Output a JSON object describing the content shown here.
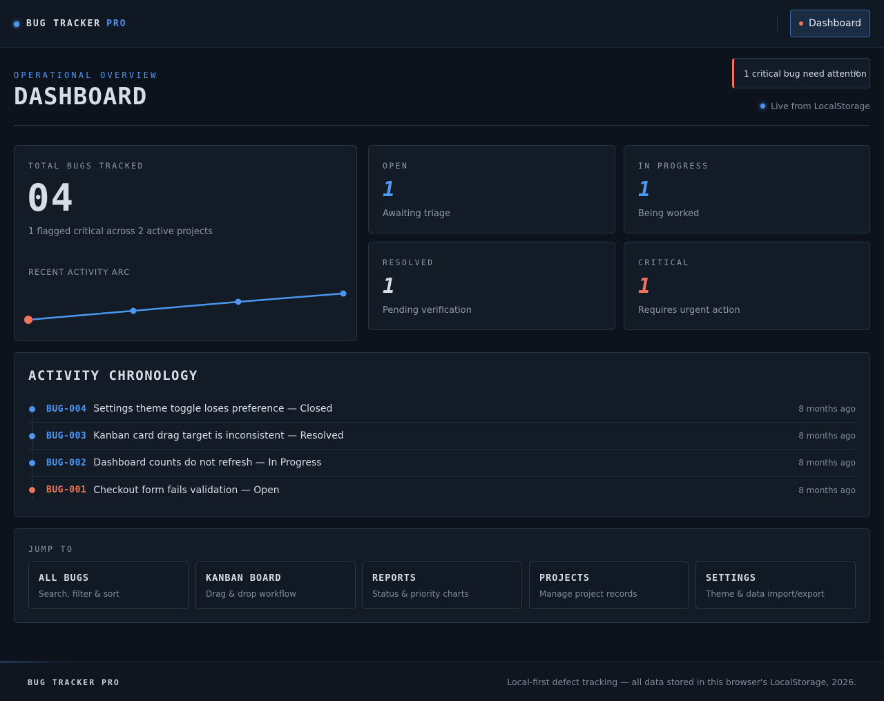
{
  "app": {
    "brand": "BUG TRACKER",
    "brand_suffix": "PRO"
  },
  "nav": {
    "active_label": "Dashboard"
  },
  "header": {
    "eyebrow": "OPERATIONAL OVERVIEW",
    "title": "DASHBOARD"
  },
  "alert": {
    "text": "1 critical bug need attention",
    "close": "×"
  },
  "live": {
    "text": "Live from LocalStorage"
  },
  "total": {
    "label": "TOTAL BUGS TRACKED",
    "value": "04",
    "subtitle": "1 flagged critical across 2 active projects",
    "arc_label": "RECENT ACTIVITY ARC"
  },
  "stats": {
    "open": {
      "label": "OPEN",
      "value": "1",
      "sub": "Awaiting triage",
      "color": "#4d97f0"
    },
    "in_progress": {
      "label": "IN PROGRESS",
      "value": "1",
      "sub": "Being worked",
      "color": "#4d97f0"
    },
    "resolved": {
      "label": "RESOLVED",
      "value": "1",
      "sub": "Pending verification",
      "color": "#d6dde6"
    },
    "critical": {
      "label": "CRITICAL",
      "value": "1",
      "sub": "Requires urgent action",
      "color": "#f0745a"
    }
  },
  "activity": {
    "title": "ACTIVITY CHRONOLOGY",
    "items": [
      {
        "id": "BUG-004",
        "text": "Settings theme toggle loses preference — Closed",
        "time": "8 months ago",
        "color": "#4d97f0"
      },
      {
        "id": "BUG-003",
        "text": "Kanban card drag target is inconsistent — Resolved",
        "time": "8 months ago",
        "color": "#4d97f0"
      },
      {
        "id": "BUG-002",
        "text": "Dashboard counts do not refresh — In Progress",
        "time": "8 months ago",
        "color": "#4d97f0"
      },
      {
        "id": "BUG-001",
        "text": "Checkout form fails validation — Open",
        "time": "8 months ago",
        "color": "#f0745a"
      }
    ]
  },
  "jump": {
    "label": "JUMP TO",
    "tiles": [
      {
        "title": "ALL BUGS",
        "sub": "Search, filter & sort"
      },
      {
        "title": "KANBAN BOARD",
        "sub": "Drag & drop workflow"
      },
      {
        "title": "REPORTS",
        "sub": "Status & priority charts"
      },
      {
        "title": "PROJECTS",
        "sub": "Manage project records"
      },
      {
        "title": "SETTINGS",
        "sub": "Theme & data import/export"
      }
    ]
  },
  "footer": {
    "brand": "BUG TRACKER PRO",
    "note": "Local-first defect tracking — all data stored in this browser's LocalStorage, 2026."
  },
  "colors": {
    "accent": "#4d97f0",
    "critical": "#f0745a",
    "background": "#0d131d"
  }
}
